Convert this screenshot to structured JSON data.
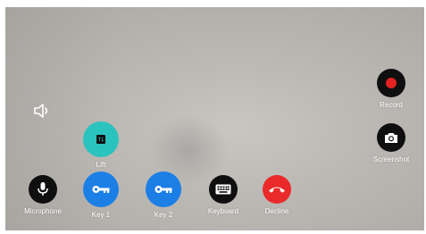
{
  "controls": {
    "record": {
      "label": "Record",
      "icon": "record-icon"
    },
    "screenshot": {
      "label": "Screenshot",
      "icon": "camera-icon"
    },
    "lift": {
      "label": "Lift",
      "icon": "elevator-icon"
    },
    "microphone": {
      "label": "Microphone",
      "icon": "microphone-icon"
    },
    "key1": {
      "label": "Key 1",
      "icon": "key-icon"
    },
    "key2": {
      "label": "Key 2",
      "icon": "key-icon"
    },
    "keyboard": {
      "label": "Keyboard",
      "icon": "keyboard-icon"
    },
    "decline": {
      "label": "Decline",
      "icon": "hang-up-icon"
    },
    "speaker": {
      "icon": "speaker-icon"
    }
  },
  "colors": {
    "button_dark": "#0f0f10",
    "key_blue": "#1c7fe6",
    "lift_teal": "#2bc3bd",
    "decline_red": "#ea2a2a",
    "record_dot": "#e32222"
  }
}
